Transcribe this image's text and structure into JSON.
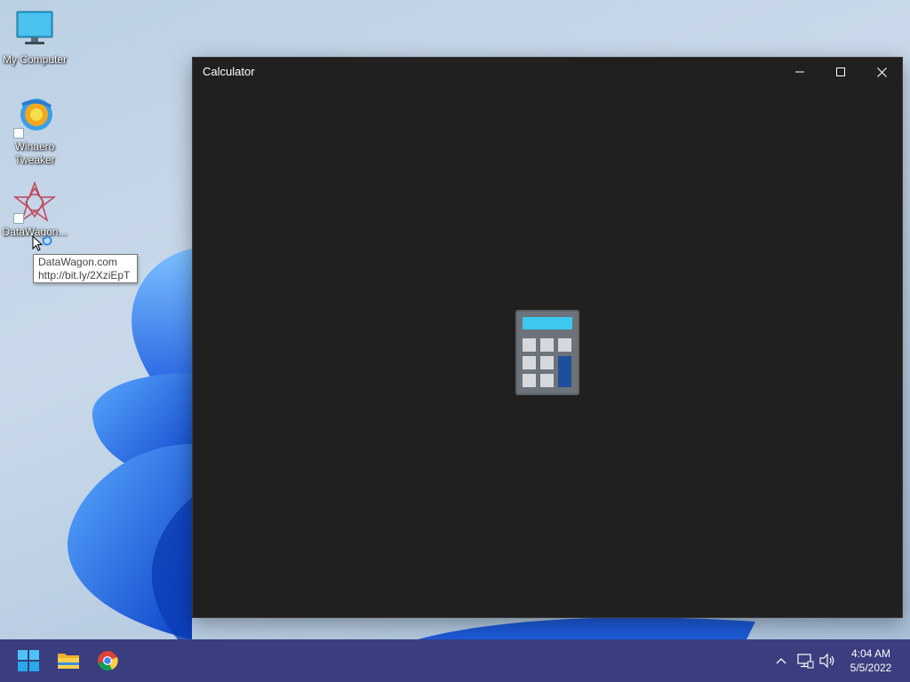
{
  "desktop": {
    "icons": [
      {
        "label": "My Computer",
        "icon": "monitor-icon"
      },
      {
        "label": "Winaero\nTweaker",
        "icon": "winaero-tweaker-icon"
      },
      {
        "label": "DataWagon...",
        "icon": "datawagon-icon"
      }
    ],
    "tooltip": {
      "line1": "DataWagon.com",
      "line2": "http://bit.ly/2XziEpT"
    }
  },
  "window": {
    "title": "Calculator",
    "controls": [
      "minimize-icon",
      "maximize-icon",
      "close-icon"
    ],
    "splash_icon": "calculator-icon",
    "background": "#202020"
  },
  "taskbar": {
    "background": "#3a3d7e",
    "pinned": [
      "windows-start-icon",
      "file-explorer-icon",
      "chrome-icon"
    ],
    "tray_icons": [
      "chevron-up-icon",
      "network-icon",
      "volume-icon"
    ],
    "clock": {
      "time": "4:04 AM",
      "date": "5/5/2022"
    }
  },
  "colors": {
    "accent_blue": "#2f6fe8",
    "calc_screen": "#3cc8ef",
    "calc_key_dark": "#1f4f9c"
  }
}
